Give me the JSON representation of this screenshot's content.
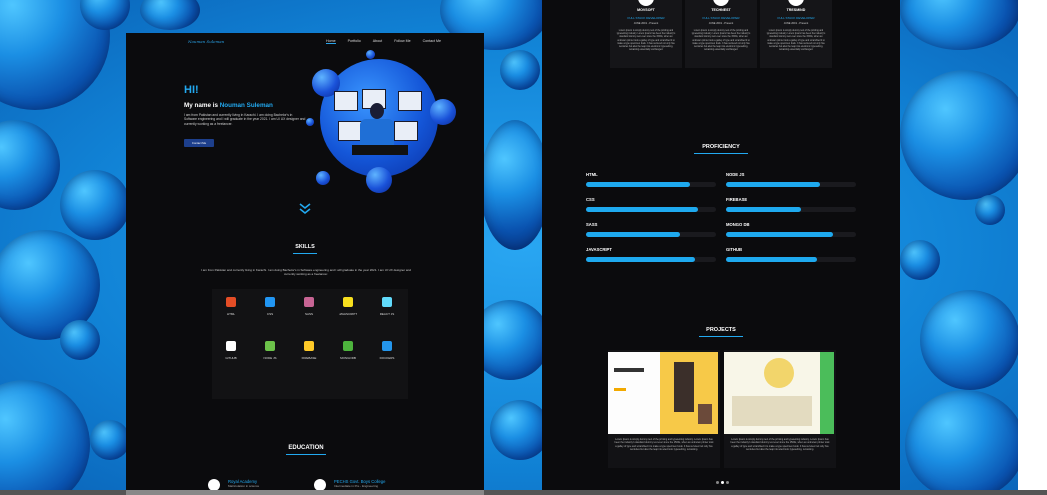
{
  "colors": {
    "accent": "#22a9f0",
    "panel": "#0b0b0d",
    "bubble": "#1a8fe0"
  },
  "nav": {
    "logo": "Nouman Suleman",
    "links": [
      "Home",
      "Portfolio",
      "About",
      "Follow Me",
      "Contact Me"
    ]
  },
  "hero": {
    "greeting": "HI!",
    "name_prefix": "My name is ",
    "name": "Nouman Suleman",
    "intro": "I am from Pakistan and currently living in Karachi. I am doing Bachelor's in Software engineering and I will graduate in the year 2021. I am UI UX designer and currently working as a freelancer.",
    "cta": "Contact Me"
  },
  "skills": {
    "title": "SKILLS",
    "description": "I am from Pakistan and currently living in Karachi. I am doing Bachelor's in Software engineering and I will graduate in the year 2021. I am UI UX designer and currently working as a freelancer.",
    "items": [
      {
        "label": "HTML",
        "icon": "html5-icon",
        "color": "#e44d26"
      },
      {
        "label": "CSS",
        "icon": "css3-icon",
        "color": "#2196f3"
      },
      {
        "label": "SASS",
        "icon": "sass-icon",
        "color": "#c76494"
      },
      {
        "label": "JAVASCRIPT",
        "icon": "javascript-icon",
        "color": "#f7df1e"
      },
      {
        "label": "REACT JS",
        "icon": "react-icon",
        "color": "#61dafb"
      },
      {
        "label": "GITHUB",
        "icon": "github-icon",
        "color": "#ffffff"
      },
      {
        "label": "NODE JS",
        "icon": "nodejs-icon",
        "color": "#6cc24a"
      },
      {
        "label": "FIREBASE",
        "icon": "firebase-icon",
        "color": "#ffca28"
      },
      {
        "label": "MONGODB",
        "icon": "mongodb-icon",
        "color": "#4db33d"
      },
      {
        "label": "DOCKERS",
        "icon": "docker-icon",
        "color": "#2496ed"
      }
    ]
  },
  "education": {
    "title": "EDUCATION",
    "items": [
      {
        "name": "Royal Academy",
        "sub": "Matriculation in science"
      },
      {
        "name": "PECHS Govt. Boys College",
        "sub": "Intermediate in Pre - Engineering"
      }
    ]
  },
  "experience": [
    {
      "company": "MOVSOFT",
      "role": "FULL STACK DEVELOPER",
      "date": "JUNE 2019 - Present",
      "desc": "Lorem Ipsum is simply dummy text of the printing and typesetting industry. Lorem Ipsum has been the industry's standard dummy text ever since the 1500s, when an unknown printer took a galley of type and scrambled it to make a type specimen book. It has survived not only five centuries but also the leap into electronic typesetting, remaining essentially unchanged."
    },
    {
      "company": "TECHNEST",
      "role": "FULL STACK DEVELOPER",
      "date": "JUNE 2019 - Present",
      "desc": "Lorem Ipsum is simply dummy text of the printing and typesetting industry. Lorem Ipsum has been the industry's standard dummy text ever since the 1500s, when an unknown printer took a galley of type and scrambled it to make a type specimen book. It has survived not only five centuries but also the leap into electronic typesetting, remaining essentially unchanged."
    },
    {
      "company": "TRESMIND",
      "role": "FULL STACK DEVELOPER",
      "date": "JUNE 2019 - Present",
      "desc": "Lorem Ipsum is simply dummy text of the printing and typesetting industry. Lorem Ipsum has been the industry's standard dummy text ever since the 1500s, when an unknown printer took a galley of type and scrambled it to make a type specimen book. It has survived not only five centuries but also the leap into electronic typesetting, remaining essentially unchanged."
    }
  ],
  "proficiency": {
    "title": "PROFICIENCY",
    "items": [
      {
        "label": "HTML",
        "level": 0.8
      },
      {
        "label": "NODE JS",
        "level": 0.72
      },
      {
        "label": "CSS",
        "level": 0.86
      },
      {
        "label": "FIREBASE",
        "level": 0.58
      },
      {
        "label": "SASS",
        "level": 0.72
      },
      {
        "label": "MONGO DB",
        "level": 0.82
      },
      {
        "label": "JAVASCRIPT",
        "level": 0.84
      },
      {
        "label": "GITHUB",
        "level": 0.7
      }
    ]
  },
  "projects": {
    "title": "PROJECTS",
    "items": [
      {
        "desc": "Lorem Ipsum is simply dummy text of the printing and typesetting industry. Lorem Ipsum has been the industry's standard dummy text ever since the 1500s, when an unknown printer took a galley of type and scrambled it to make a type specimen book. It has survived not only five centuries but also the leap into electronic typesetting, remaining."
      },
      {
        "desc": "Lorem Ipsum is simply dummy text of the printing and typesetting industry. Lorem Ipsum has been the industry's standard dummy text ever since the 1500s, when an unknown printer took a galley of type and scrambled it to make a type specimen book. It has survived not only five centuries but also the leap into electronic typesetting, remaining."
      }
    ],
    "slider_active": 1,
    "slider_count": 3
  }
}
